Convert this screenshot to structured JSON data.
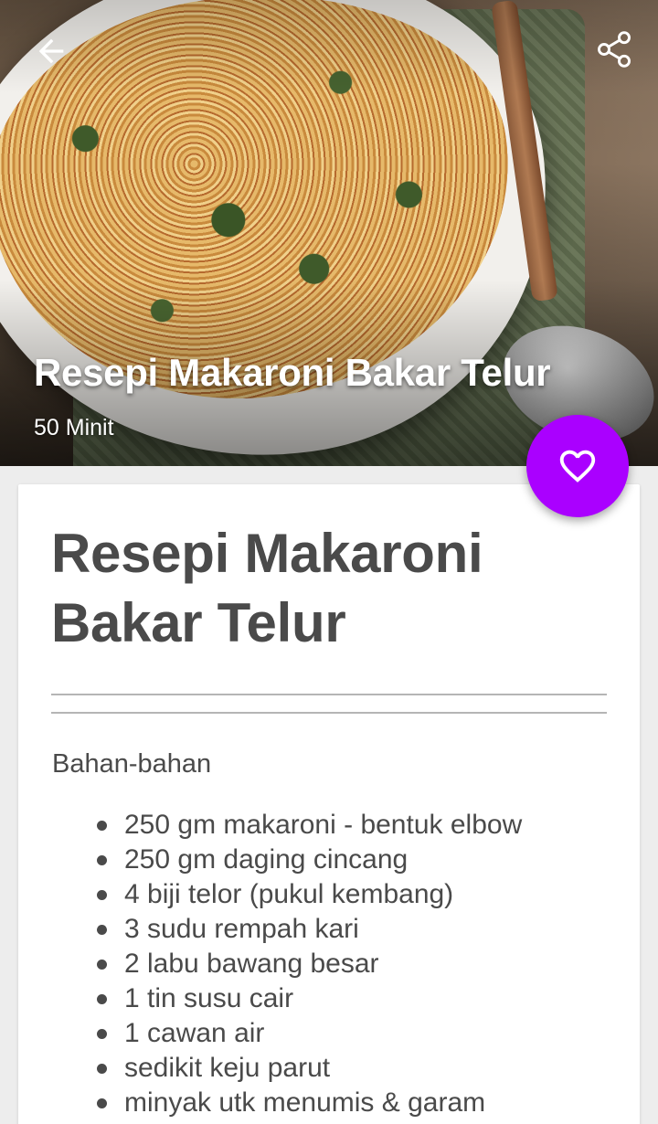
{
  "hero": {
    "title": "Resepi Makaroni Bakar Telur",
    "time": "50 Minit",
    "back_icon": "arrow-left-icon",
    "share_icon": "share-icon"
  },
  "card": {
    "title": "Resepi Makaroni Bakar Telur",
    "section_label": "Bahan-bahan",
    "ingredients": [
      "250 gm makaroni -  bentuk elbow",
      "250 gm daging cincang",
      "4 biji telor (pukul kembang)",
      "3 sudu rempah kari",
      "2 labu bawang besar",
      "1 tin susu cair",
      "1 cawan air",
      "sedikit keju parut",
      "minyak utk menumis & garam"
    ]
  },
  "fab": {
    "icon": "heart-outline-icon",
    "color": "#aa00ff"
  }
}
